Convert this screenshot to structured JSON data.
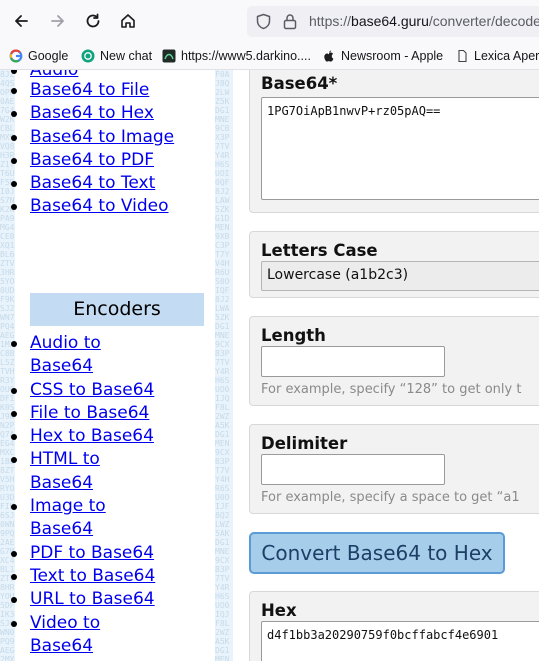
{
  "browser": {
    "url_prefix": "https://",
    "url_host": "base64.guru",
    "url_path": "/converter/decode"
  },
  "bookmarks": [
    {
      "label": "Google",
      "icon": "google-icon"
    },
    {
      "label": "New chat",
      "icon": "chatgpt-icon"
    },
    {
      "label": "https://www5.darkino....",
      "icon": "site-icon"
    },
    {
      "label": "Newsroom - Apple",
      "icon": "apple-icon"
    },
    {
      "label": "Lexica Apert",
      "icon": "page-icon"
    }
  ],
  "sidebar": {
    "decoders_partial_top": "Audio",
    "decoders": [
      "Base64 to File",
      "Base64 to Hex",
      "Base64 to Image",
      "Base64 to PDF",
      "Base64 to Text",
      "Base64 to Video"
    ],
    "encoders_heading": "Encoders",
    "encoders": [
      "Audio to Base64",
      "CSS to Base64",
      "File to Base64",
      "Hex to Base64",
      "HTML to Base64",
      "Image to Base64",
      "PDF to Base64",
      "Text to Base64",
      "URL to Base64",
      "Video to Base64"
    ]
  },
  "form": {
    "base64_label": "Base64*",
    "base64_value": "1PG7OiApB1nwvP+rz05pAQ==",
    "letters_case_label": "Letters Case",
    "letters_case_value": "Lowercase (a1b2c3)",
    "length_label": "Length",
    "length_hint": "For example, specify “128” to get only t",
    "delimiter_label": "Delimiter",
    "delimiter_hint": "For example, specify a space to get “a1",
    "convert_button": "Convert Base64 to Hex",
    "hex_label": "Hex",
    "hex_value": "d4f1bb3a20290759f0bcffabcf4e6901"
  }
}
